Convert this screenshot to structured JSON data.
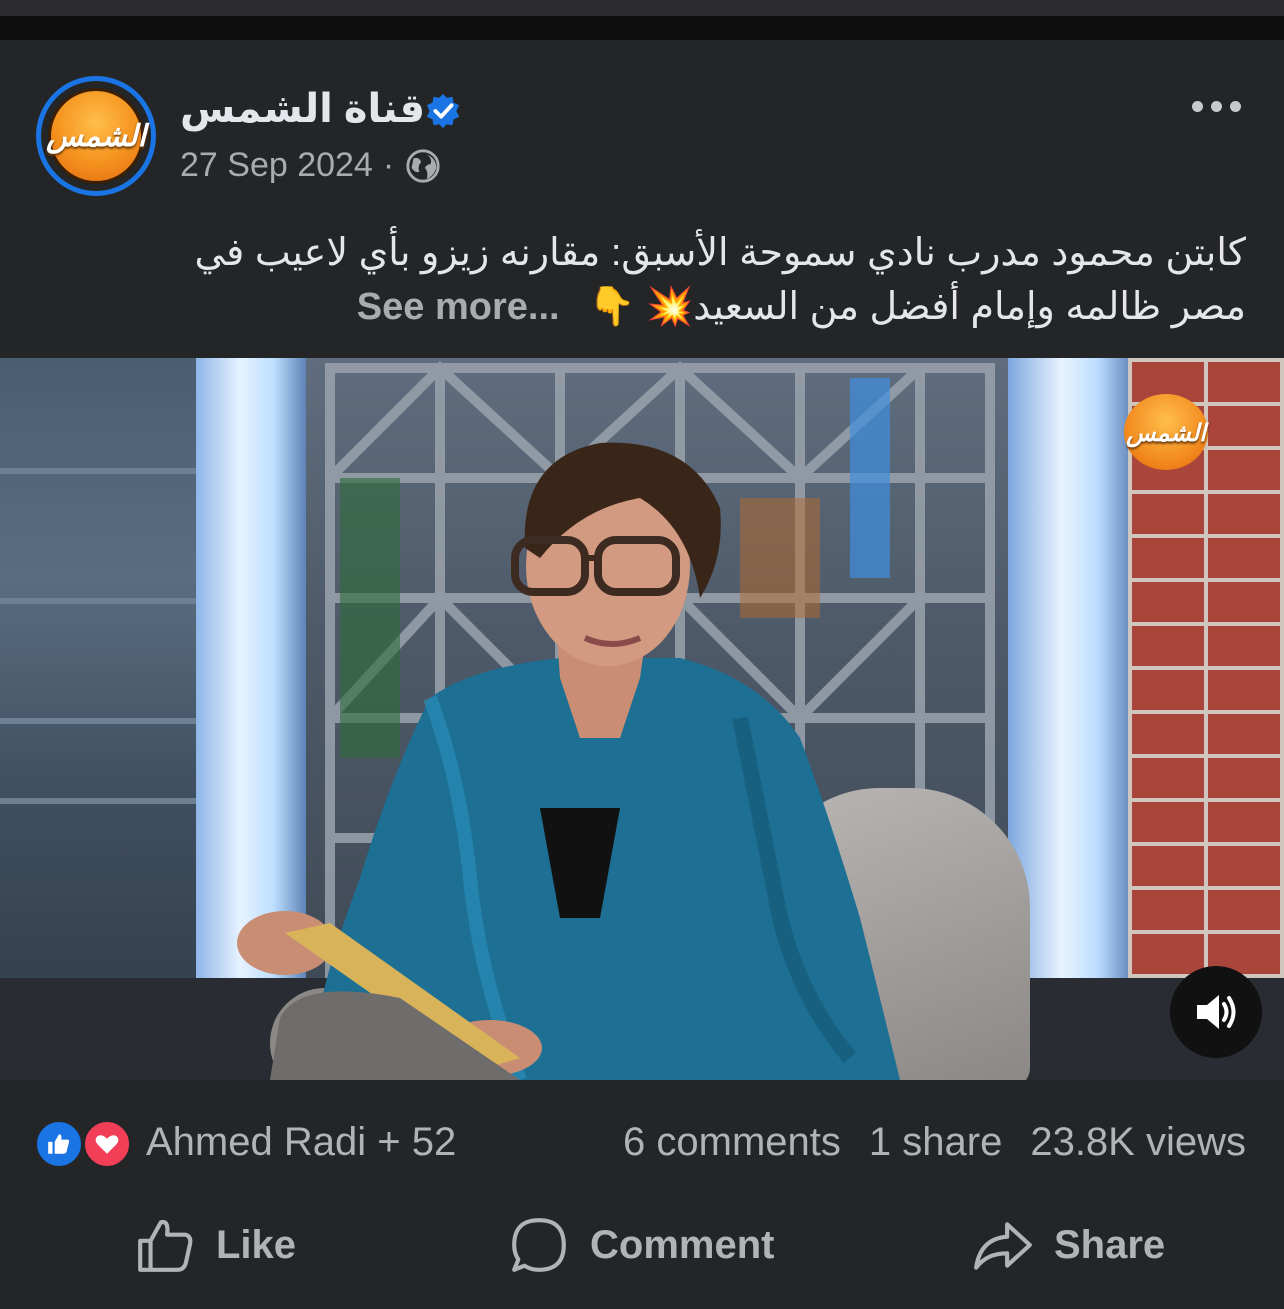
{
  "post": {
    "page_name": "قناة الشمس",
    "date": "27 Sep 2024",
    "separator": "·",
    "caption_line1": "كابتن محمود مدرب نادي سموحة الأسبق: مقارنه زيزو بأي لاعيب في",
    "caption_line2": "مصر ظالمه وإمام أفضل من السعيد💥 👇",
    "see_more": "See more..."
  },
  "logo": {
    "text": "الشمس"
  },
  "stats": {
    "reactors": "Ahmed Radi + 52",
    "comments": "6 comments",
    "shares": "1 share",
    "views": "23.8K views"
  },
  "actions": {
    "like": "Like",
    "comment": "Comment",
    "share": "Share"
  },
  "icons": {
    "verified": "verified-badge-icon",
    "privacy": "globe-icon",
    "more": "more-options-icon",
    "sound": "speaker-icon",
    "reaction_like": "thumbs-up-reaction-icon",
    "reaction_love": "heart-reaction-icon"
  },
  "colors": {
    "background": "#242526",
    "accent_blue": "#1b74e4",
    "love_red": "#f33e58",
    "secondary_text": "#b0b3b8"
  }
}
